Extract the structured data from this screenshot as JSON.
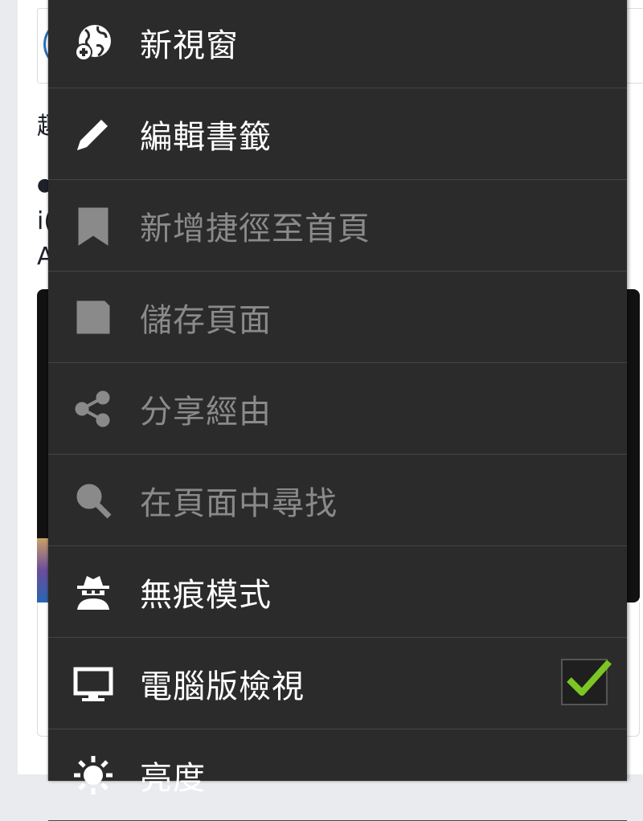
{
  "background": {
    "text_fragments": [
      "趣",
      "●",
      "i(",
      "A"
    ]
  },
  "menu": {
    "items": [
      {
        "label": "新視窗",
        "icon": "new-window-globe-icon",
        "enabled": true
      },
      {
        "label": "編輯書籤",
        "icon": "pencil-icon",
        "enabled": true
      },
      {
        "label": "新增捷徑至首頁",
        "icon": "bookmark-home-icon",
        "enabled": false
      },
      {
        "label": "儲存頁面",
        "icon": "save-icon",
        "enabled": false
      },
      {
        "label": "分享經由",
        "icon": "share-icon",
        "enabled": false
      },
      {
        "label": "在頁面中尋找",
        "icon": "search-icon",
        "enabled": false
      },
      {
        "label": "無痕模式",
        "icon": "incognito-icon",
        "enabled": true
      },
      {
        "label": "電腦版檢視",
        "icon": "desktop-monitor-icon",
        "enabled": true,
        "checked": true
      },
      {
        "label": "亮度",
        "icon": "brightness-icon",
        "enabled": true
      }
    ]
  },
  "colors": {
    "menu_bg": "#2b2b2b",
    "enabled_text": "#ffffff",
    "disabled_text": "#8a8a8a",
    "check_mark": "#7cc623"
  }
}
